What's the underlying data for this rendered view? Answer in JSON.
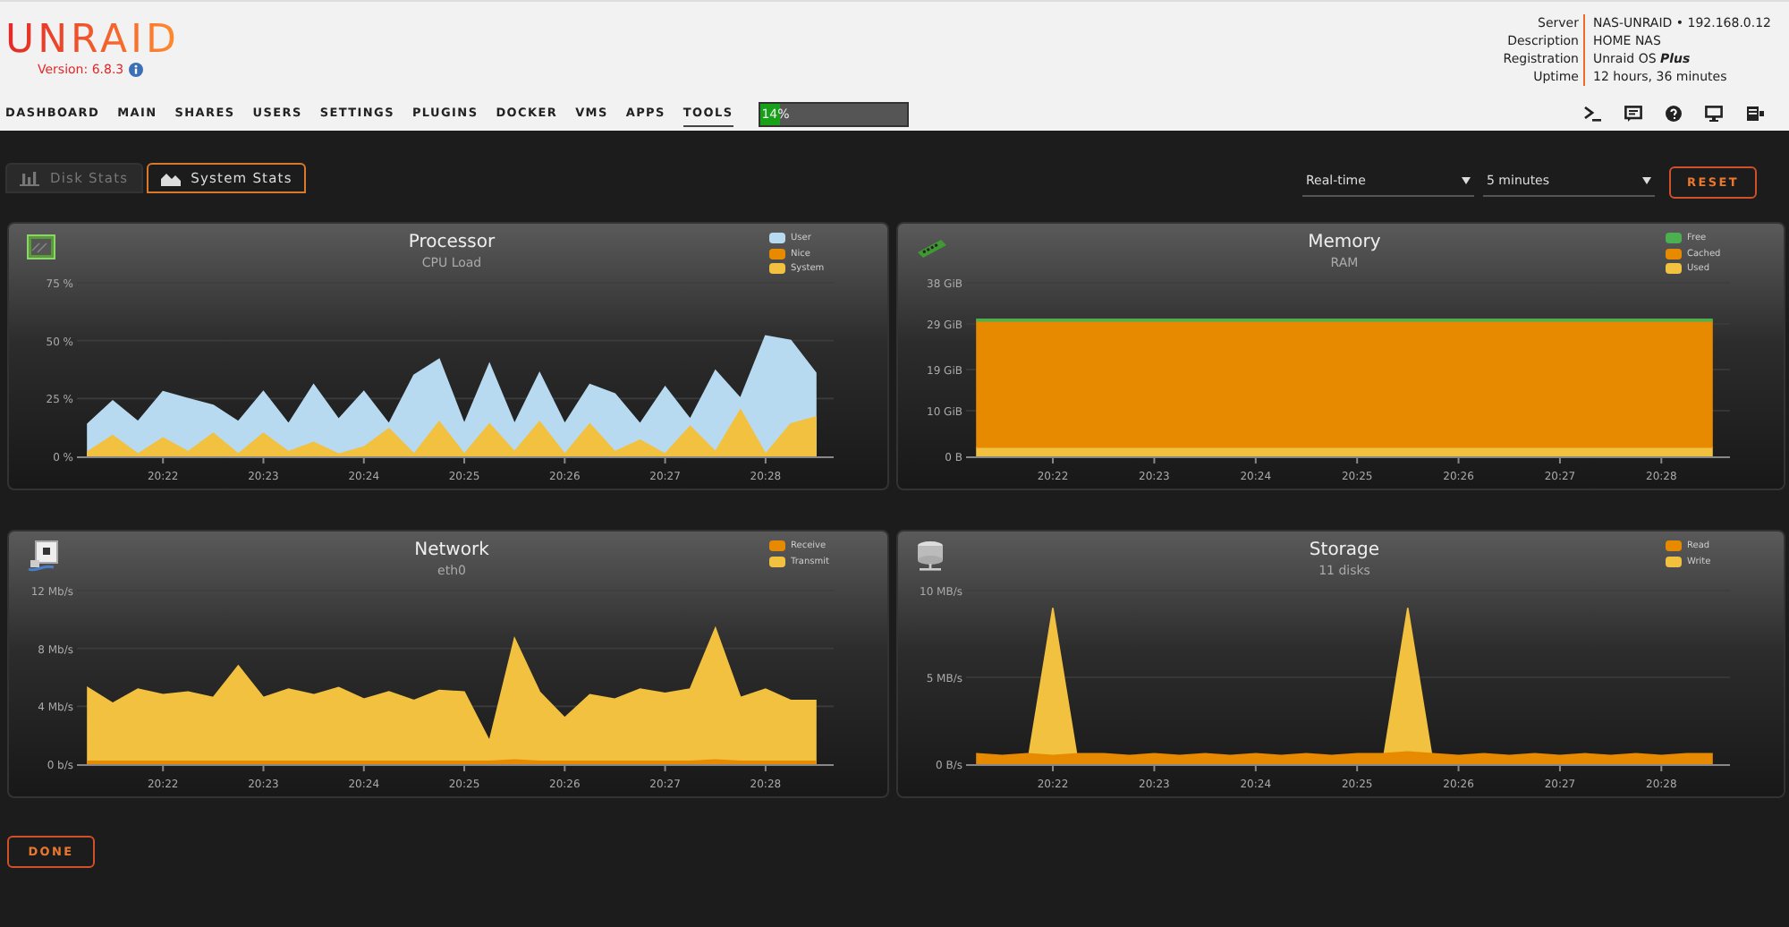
{
  "header": {
    "logo": "UNRAID",
    "version": "Version: 6.8.3",
    "server_info": [
      {
        "label": "Server",
        "value": "NAS-UNRAID • 192.168.0.12"
      },
      {
        "label": "Description",
        "value": "HOME NAS"
      },
      {
        "label": "Registration",
        "value": "Unraid OS **Plus**"
      },
      {
        "label": "Uptime",
        "value": "12 hours, 36 minutes"
      }
    ]
  },
  "nav": {
    "items": [
      {
        "label": "DASHBOARD",
        "selected": false
      },
      {
        "label": "MAIN",
        "selected": false
      },
      {
        "label": "SHARES",
        "selected": false
      },
      {
        "label": "USERS",
        "selected": false
      },
      {
        "label": "SETTINGS",
        "selected": false
      },
      {
        "label": "PLUGINS",
        "selected": false
      },
      {
        "label": "DOCKER",
        "selected": false
      },
      {
        "label": "VMS",
        "selected": false
      },
      {
        "label": "APPS",
        "selected": false
      },
      {
        "label": "TOOLS",
        "selected": true
      }
    ],
    "cpu_meter": {
      "label": "14%",
      "level": 0.14
    }
  },
  "tabs": [
    {
      "label": "Disk Stats",
      "selected": false
    },
    {
      "label": "System Stats",
      "selected": true
    }
  ],
  "controls": {
    "range": {
      "value": "Real-time"
    },
    "period": {
      "value": "5 minutes"
    },
    "reset": "RESET"
  },
  "panels": [
    {
      "kind": "cpu",
      "title": "Processor",
      "subtitle": "CPU Load",
      "chart_data": {
        "type": "area",
        "grid": true,
        "stacked": false,
        "ylim": [
          0,
          75
        ],
        "yticks": [
          {
            "value": 0,
            "label": "0 %"
          },
          {
            "value": 25,
            "label": "25 %"
          },
          {
            "value": 50,
            "label": "50 %"
          },
          {
            "value": 75,
            "label": "75 %"
          }
        ],
        "categories": [
          null,
          null,
          null,
          "20:22",
          null,
          null,
          null,
          "20:23",
          null,
          null,
          null,
          "20:24",
          null,
          null,
          null,
          "20:25",
          null,
          null,
          null,
          "20:26",
          null,
          null,
          null,
          "20:27",
          null,
          null,
          null,
          "20:28",
          null,
          null
        ],
        "series": [
          {
            "name": "User",
            "color": "#b8daf0",
            "values": [
              14,
              24,
              15,
              28,
              25,
              22,
              15,
              28,
              14,
              31,
              16,
              28,
              14,
              35,
              42,
              14,
              40,
              14,
              36,
              14,
              31,
              27,
              14,
              30,
              16,
              37,
              25,
              52,
              50,
              36
            ]
          },
          {
            "name": "Nice",
            "color": "#e88a00",
            "values": [
              null,
              null,
              null,
              null,
              null,
              null,
              null,
              null,
              null,
              null,
              null,
              null,
              null,
              null,
              null,
              null,
              null,
              null,
              null,
              null,
              null,
              null,
              null,
              null,
              null,
              null,
              null,
              null,
              null,
              null
            ]
          },
          {
            "name": "System",
            "color": "#f2c140",
            "values": [
              2,
              9,
              1,
              8,
              2,
              10,
              1,
              10,
              2,
              6,
              1,
              4,
              12,
              1,
              15,
              1,
              14,
              2,
              15,
              1,
              14,
              2,
              7,
              1,
              13,
              2,
              20,
              1,
              14,
              17
            ]
          }
        ]
      }
    },
    {
      "kind": "memory",
      "title": "Memory",
      "subtitle": "RAM",
      "chart_data": {
        "type": "area",
        "grid": true,
        "stacked": true,
        "ylim": [
          0,
          38
        ],
        "yticks": [
          {
            "value": 0,
            "label": "0 B"
          },
          {
            "value": 10,
            "label": "10 GiB"
          },
          {
            "value": 19,
            "label": "19 GiB"
          },
          {
            "value": 29,
            "label": "29 GiB"
          },
          {
            "value": 38,
            "label": "38 GiB"
          }
        ],
        "categories": [
          null,
          null,
          null,
          "20:22",
          null,
          null,
          null,
          "20:23",
          null,
          null,
          null,
          "20:24",
          null,
          null,
          null,
          "20:25",
          null,
          null,
          null,
          "20:26",
          null,
          null,
          null,
          "20:27",
          null,
          null,
          null,
          "20:28",
          null,
          null
        ],
        "series": [
          {
            "name": "Free",
            "color": "#4caf50",
            "values": [
              0.4,
              0.4,
              0.4,
              0.4,
              0.4,
              0.4,
              0.4,
              0.4,
              0.4,
              0.4,
              0.4,
              0.4,
              0.4,
              0.4,
              0.4,
              0.4,
              0.4,
              0.4,
              0.4,
              0.4,
              0.4,
              0.4,
              0.4,
              0.4,
              0.4,
              0.4,
              0.4,
              0.4,
              0.4,
              0.4
            ]
          },
          {
            "name": "Cached",
            "color": "#e88a00",
            "values": [
              27.6,
              27.6,
              27.6,
              27.6,
              27.6,
              27.6,
              27.6,
              27.6,
              27.6,
              27.6,
              27.6,
              27.6,
              27.6,
              27.6,
              27.6,
              27.6,
              27.6,
              27.6,
              27.6,
              27.6,
              27.6,
              27.6,
              27.6,
              27.6,
              27.6,
              27.6,
              27.6,
              27.6,
              27.6,
              27.6
            ]
          },
          {
            "name": "Used",
            "color": "#f2c140",
            "values": [
              2,
              2,
              2,
              2,
              2,
              2,
              2,
              2,
              2,
              2,
              2,
              2,
              2,
              2,
              2,
              2,
              2,
              2,
              2,
              2,
              2,
              2,
              2,
              2,
              2,
              2,
              2,
              2,
              2,
              2
            ]
          }
        ]
      }
    },
    {
      "kind": "network",
      "title": "Network",
      "subtitle": "eth0",
      "chart_data": {
        "type": "area",
        "grid": true,
        "stacked": false,
        "ylim": [
          0,
          12
        ],
        "yticks": [
          {
            "value": 0,
            "label": "0 b/s"
          },
          {
            "value": 4,
            "label": "4 Mb/s"
          },
          {
            "value": 8,
            "label": "8 Mb/s"
          },
          {
            "value": 12,
            "label": "12 Mb/s"
          }
        ],
        "categories": [
          null,
          null,
          null,
          "20:22",
          null,
          null,
          null,
          "20:23",
          null,
          null,
          null,
          "20:24",
          null,
          null,
          null,
          "20:25",
          null,
          null,
          null,
          "20:26",
          null,
          null,
          null,
          "20:27",
          null,
          null,
          null,
          "20:28",
          null,
          null
        ],
        "series": [
          {
            "name": "Receive",
            "color": "#e88a00",
            "values": [
              0.2,
              0.2,
              0.2,
              0.2,
              0.2,
              0.2,
              0.2,
              0.2,
              0.2,
              0.2,
              0.2,
              0.2,
              0.2,
              0.2,
              0.2,
              0.2,
              0.2,
              0.3,
              0.2,
              0.2,
              0.2,
              0.2,
              0.2,
              0.2,
              0.2,
              0.3,
              0.2,
              0.2,
              0.2,
              0.2
            ]
          },
          {
            "name": "Transmit",
            "color": "#f2c140",
            "values": [
              5.3,
              4.2,
              5.2,
              4.8,
              5.0,
              4.6,
              6.8,
              4.6,
              5.2,
              4.8,
              5.3,
              4.5,
              5.0,
              4.4,
              5.1,
              5.0,
              1.6,
              8.7,
              5.0,
              3.2,
              4.8,
              4.5,
              5.2,
              4.9,
              5.2,
              9.4,
              4.6,
              5.2,
              4.4,
              4.4
            ]
          }
        ]
      }
    },
    {
      "kind": "storage",
      "title": "Storage",
      "subtitle": "11 disks",
      "chart_data": {
        "type": "area",
        "grid": true,
        "stacked": false,
        "ylim": [
          0,
          10
        ],
        "yticks": [
          {
            "value": 0,
            "label": "0 B/s"
          },
          {
            "value": 5,
            "label": "5 MB/s"
          },
          {
            "value": 10,
            "label": "10 MB/s"
          }
        ],
        "categories": [
          null,
          null,
          null,
          "20:22",
          null,
          null,
          null,
          "20:23",
          null,
          null,
          null,
          "20:24",
          null,
          null,
          null,
          "20:25",
          null,
          null,
          null,
          "20:26",
          null,
          null,
          null,
          "20:27",
          null,
          null,
          null,
          "20:28",
          null,
          null
        ],
        "series": [
          {
            "name": "Read",
            "color": "#e88a00",
            "values": [
              0.6,
              0.5,
              0.6,
              0.5,
              0.6,
              0.6,
              0.5,
              0.6,
              0.5,
              0.6,
              0.5,
              0.6,
              0.5,
              0.6,
              0.5,
              0.6,
              0.6,
              0.7,
              0.6,
              0.5,
              0.6,
              0.5,
              0.6,
              0.5,
              0.6,
              0.5,
              0.6,
              0.5,
              0.6,
              0.6
            ]
          },
          {
            "name": "Write",
            "color": "#f2c140",
            "values": [
              0,
              0,
              0,
              9,
              0,
              0,
              0,
              0,
              0,
              0,
              0,
              0,
              0,
              0,
              0,
              0,
              0,
              9,
              0,
              0,
              0,
              0,
              0,
              0,
              0,
              0,
              0,
              0,
              0,
              0
            ]
          }
        ]
      }
    }
  ],
  "done": "DONE"
}
